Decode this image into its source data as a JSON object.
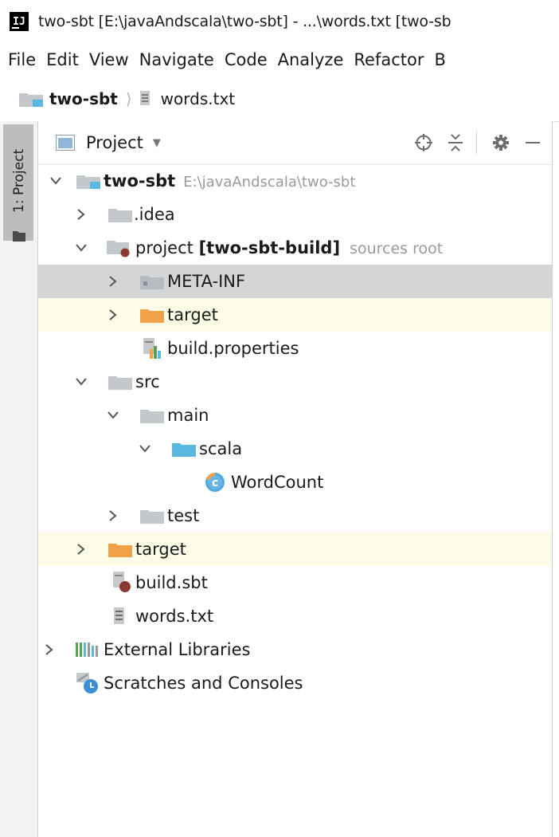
{
  "window": {
    "title": "two-sbt [E:\\javaAndscala\\two-sbt] - ...\\words.txt [two-sb"
  },
  "menu": [
    "File",
    "Edit",
    "View",
    "Navigate",
    "Code",
    "Analyze",
    "Refactor",
    "B"
  ],
  "breadcrumb": {
    "project": "two-sbt",
    "file": "words.txt"
  },
  "side_tab": {
    "label": "1: Project"
  },
  "panel": {
    "title": "Project"
  },
  "tree": {
    "root": {
      "name": "two-sbt",
      "path": "E:\\javaAndscala\\two-sbt"
    },
    "idea": ".idea",
    "project": {
      "name": "project",
      "module": "[two-sbt-build]",
      "hint": "sources root"
    },
    "meta_inf": "META-INF",
    "project_target": "target",
    "build_properties": "build.properties",
    "src": "src",
    "main": "main",
    "scala": "scala",
    "wordcount": "WordCount",
    "test": "test",
    "target": "target",
    "build_sbt": "build.sbt",
    "words_txt": "words.txt",
    "external_libraries": "External Libraries",
    "scratches": "Scratches and Consoles"
  },
  "colors": {
    "selected_row": "#d5d5d5",
    "excluded_row": "#fcfbe5",
    "folder_gray": "#c3c8cc",
    "folder_excluded": "#f0a24a",
    "folder_source": "#5cb8e0",
    "class_icon": "#52a8e0"
  }
}
